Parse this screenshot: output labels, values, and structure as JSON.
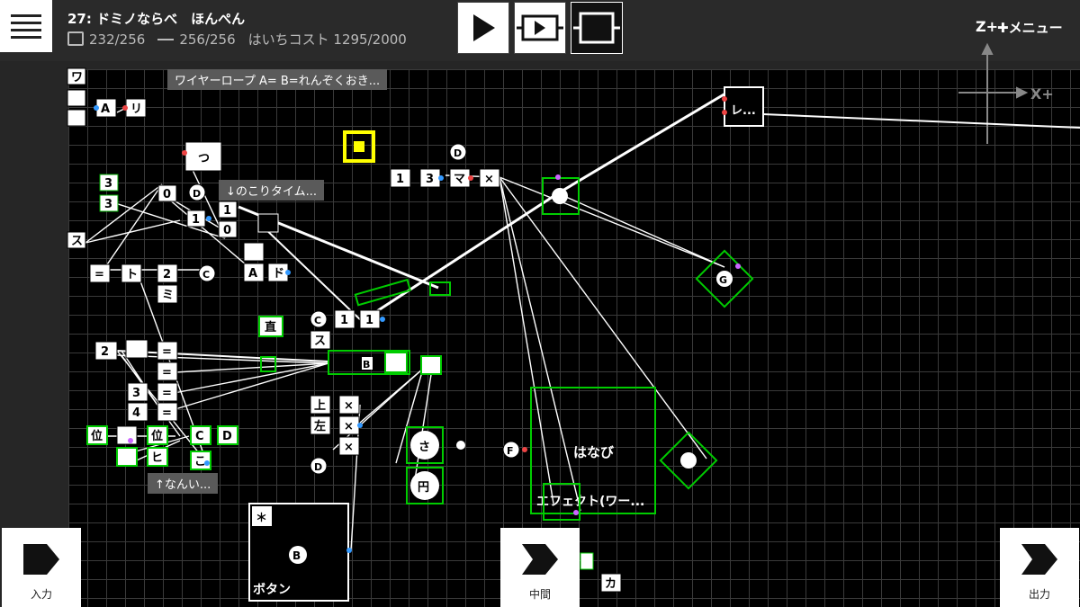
{
  "header": {
    "title": "27: ドミノならべ　ほんぺん",
    "parts_count": "232/256",
    "wire_count": "256/256",
    "cost_label": "はいちコスト 1295/2000"
  },
  "toolbar": {
    "menu_label": "メニュー",
    "z_axis": "Z+",
    "x_axis": "X+"
  },
  "notes": {
    "wire_rope": "ワイヤーロープ A= B=れんぞくおき...",
    "time_left": "↓のこりタイム...",
    "difficulty": "↑なんい..."
  },
  "nodes": {
    "wa": "ワ",
    "a": "A",
    "ri": "リ",
    "tsu": "つ",
    "d": "D",
    "c": "C",
    "b": "B",
    "n1": "1",
    "n2": "2",
    "n3": "3",
    "n4": "4",
    "n0": "0",
    "su": "ス",
    "to": "ト",
    "mi": "ミ",
    "do": "ド",
    "ma": "マ",
    "x": "×",
    "choku": "直",
    "ue": "上",
    "hidari": "左",
    "sa": "さ",
    "en": "円",
    "i": "位",
    "hi": "ヒ",
    "ko": "こ",
    "f": "F",
    "g": "G",
    "ka": "カ",
    "eq": "="
  },
  "big_nodes": {
    "hanabi": "はなび",
    "effect": "エフェクト(ワー...",
    "button_label": "ボタン",
    "button_star": "＊",
    "button_key": "B",
    "top_right": "レ..."
  },
  "bottom": {
    "input": "入力",
    "middle": "中間",
    "output": "出力"
  }
}
